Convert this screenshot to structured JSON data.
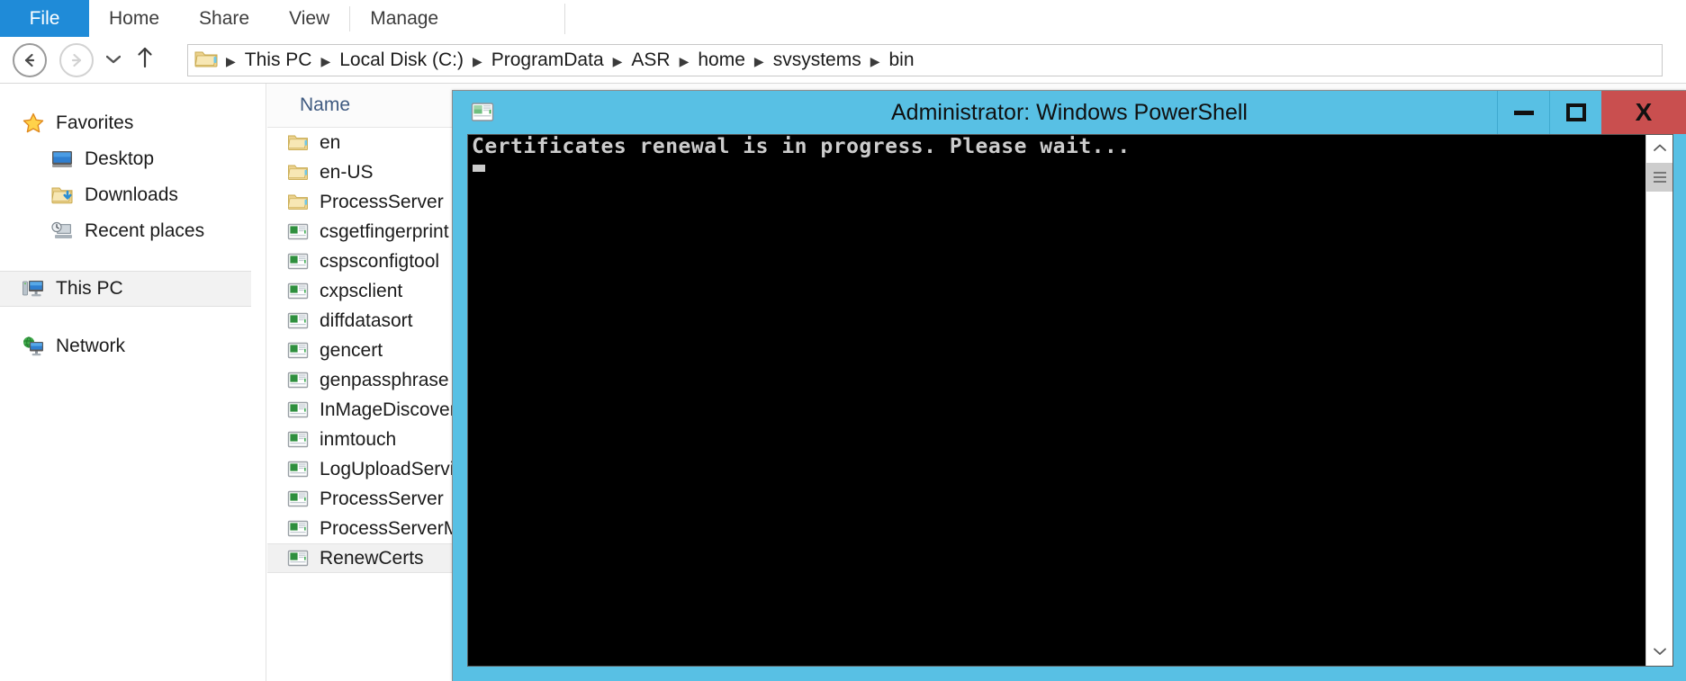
{
  "ribbon": {
    "tabs": [
      {
        "label": "File",
        "icon": "file-menu",
        "active": true
      },
      {
        "label": "Home",
        "icon": "",
        "active": false
      },
      {
        "label": "Share",
        "icon": "",
        "active": false
      },
      {
        "label": "View",
        "icon": "",
        "active": false
      },
      {
        "label": "Manage",
        "icon": "",
        "active": false
      }
    ]
  },
  "navbar": {
    "back_icon": "back-arrow-icon",
    "forward_icon": "forward-arrow-icon",
    "history_icon": "chevron-down-icon",
    "up_icon": "up-arrow-icon",
    "address_folder_icon": "folder-icon",
    "breadcrumbs": [
      "This PC",
      "Local Disk (C:)",
      "ProgramData",
      "ASR",
      "home",
      "svsystems",
      "bin"
    ],
    "separator": "▸"
  },
  "nav_pane": {
    "groups": [
      {
        "header": {
          "label": "Favorites",
          "icon": "star-icon",
          "selected": false
        },
        "items": [
          {
            "label": "Desktop",
            "icon": "desktop-icon",
            "selected": false
          },
          {
            "label": "Downloads",
            "icon": "downloads-folder-icon",
            "selected": false
          },
          {
            "label": "Recent places",
            "icon": "recent-places-icon",
            "selected": false
          }
        ]
      },
      {
        "header": {
          "label": "This PC",
          "icon": "this-pc-icon",
          "selected": true
        },
        "items": []
      },
      {
        "header": {
          "label": "Network",
          "icon": "network-icon",
          "selected": false
        },
        "items": []
      }
    ]
  },
  "file_list": {
    "column_header": "Name",
    "rows": [
      {
        "name": "en",
        "type": "folder",
        "selected": false
      },
      {
        "name": "en-US",
        "type": "folder",
        "selected": false
      },
      {
        "name": "ProcessServer",
        "type": "folder",
        "selected": false
      },
      {
        "name": "csgetfingerprint",
        "type": "application",
        "selected": false
      },
      {
        "name": "cspsconfigtool",
        "type": "application",
        "selected": false
      },
      {
        "name": "cxpsclient",
        "type": "application",
        "selected": false
      },
      {
        "name": "diffdatasort",
        "type": "application",
        "selected": false
      },
      {
        "name": "gencert",
        "type": "application",
        "selected": false
      },
      {
        "name": "genpassphrase",
        "type": "application",
        "selected": false
      },
      {
        "name": "InMageDiscovery",
        "type": "application",
        "selected": false
      },
      {
        "name": "inmtouch",
        "type": "application",
        "selected": false
      },
      {
        "name": "LogUploadService",
        "type": "application",
        "selected": false
      },
      {
        "name": "ProcessServer",
        "type": "application",
        "selected": false
      },
      {
        "name": "ProcessServerMonitor",
        "type": "application",
        "selected": false
      },
      {
        "name": "RenewCerts",
        "type": "application",
        "selected": true
      }
    ]
  },
  "powershell": {
    "title": "Administrator: Windows PowerShell",
    "system_icon": "console-window-icon",
    "controls": {
      "minimize": {
        "label": "–",
        "icon": "minimize-icon"
      },
      "maximize": {
        "label": "☐",
        "icon": "maximize-icon"
      },
      "close": {
        "label": "X",
        "icon": "close-icon"
      }
    },
    "console_lines": [
      "Certificates renewal is in progress. Please wait..."
    ],
    "cursor_visible": true,
    "scrollbar": {
      "up_icon": "scroll-up-icon",
      "down_icon": "scroll-down-icon",
      "thumb_icon": "scrollbar-thumb"
    }
  },
  "colors": {
    "ribbon_file_blue": "#1f8bd8",
    "powershell_frame": "#58c0e4",
    "powershell_close": "#c94f4f",
    "console_bg": "#000000",
    "console_fg": "#cccccc",
    "column_header_text": "#3f5a80"
  }
}
